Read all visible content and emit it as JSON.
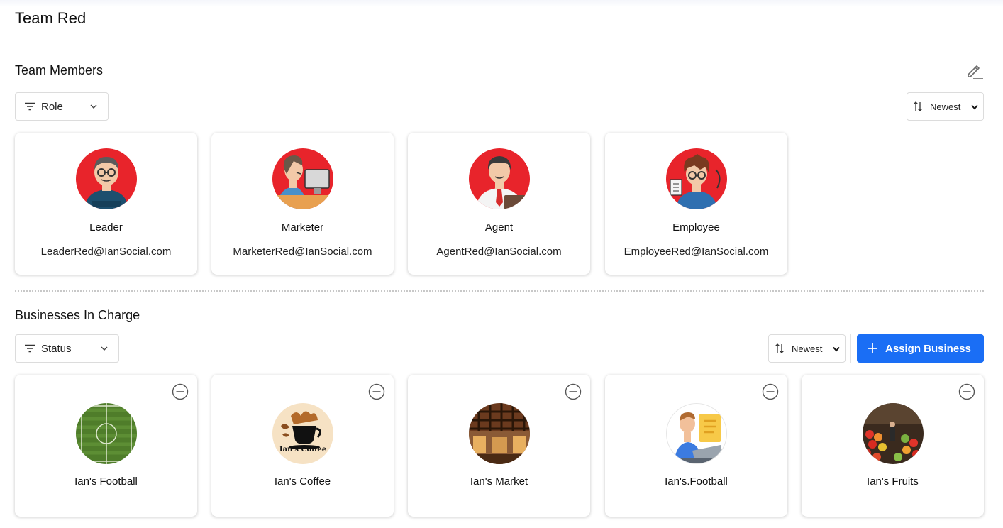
{
  "page": {
    "title": "Team Red"
  },
  "members_section": {
    "title": "Team Members",
    "filter_label": "Role",
    "sort_label": "Newest",
    "edit_icon": "pencil-icon",
    "members": [
      {
        "role": "Leader",
        "email": "LeaderRed@IanSocial.com",
        "avatar": "leader-avatar"
      },
      {
        "role": "Marketer",
        "email": "MarketerRed@IanSocial.com",
        "avatar": "marketer-avatar"
      },
      {
        "role": "Agent",
        "email": "AgentRed@IanSocial.com",
        "avatar": "agent-avatar"
      },
      {
        "role": "Employee",
        "email": "EmployeeRed@IanSocial.com",
        "avatar": "employee-avatar"
      }
    ]
  },
  "business_section": {
    "title": "Businesses In Charge",
    "filter_label": "Status",
    "sort_label": "Newest",
    "assign_label": "Assign Business",
    "businesses": [
      {
        "name": "Ian's Football",
        "image": "football-field-image"
      },
      {
        "name": "Ian's Coffee",
        "image": "coffee-logo-image",
        "logo_text": "Ian's Coffee"
      },
      {
        "name": "Ian's Market",
        "image": "market-interior-image"
      },
      {
        "name": "Ian's.Football",
        "image": "person-laptop-image"
      },
      {
        "name": "Ian's Fruits",
        "image": "fruit-stand-image"
      }
    ]
  },
  "colors": {
    "accent": "#1a6ef5",
    "avatar_red": "#e8242b"
  }
}
